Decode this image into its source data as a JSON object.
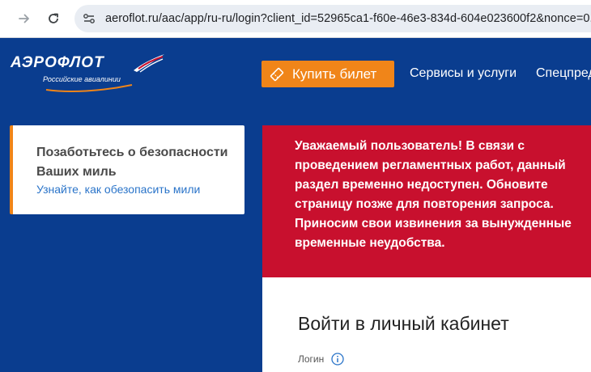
{
  "browser": {
    "url": "aeroflot.ru/aac/app/ru-ru/login?client_id=52965ca1-f60e-46e3-834d-604e023600f2&nonce=0."
  },
  "header": {
    "logo_text": "АЭРОФЛОТ",
    "logo_subtitle": "Российские авиалинии",
    "buy_ticket": "Купить билет",
    "nav": [
      "Сервисы и услуги",
      "Спецпред"
    ]
  },
  "security_card": {
    "title": "Позаботьтесь о безопасности Ваших миль",
    "link": "Узнайте, как обезопасить мили"
  },
  "error_banner": {
    "message": "Уважаемый пользователь! В связи с проведением регламентных работ, данный раздел временно недоступен. Обновите страницу позже для повторения запроса. Приносим свои извинения за вынужденные временные неудобства."
  },
  "login": {
    "title": "Войти в личный кабинет",
    "login_label": "Логин"
  },
  "colors": {
    "brand_blue": "#0a3d8f",
    "accent_orange": "#f08519",
    "error_red": "#c8102e",
    "link_blue": "#2a74c9"
  }
}
